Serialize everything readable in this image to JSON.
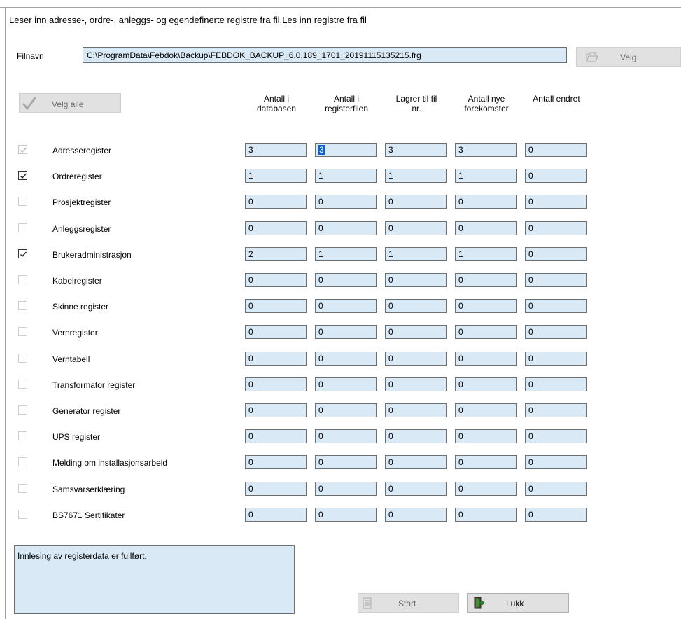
{
  "header": {
    "title": "Leser inn adresse-, ordre-, anleggs- og egendefinerte registre fra fil.Les inn registre fra fil"
  },
  "file": {
    "label": "Filnavn",
    "path": "C:\\ProgramData\\Febdok\\Backup\\FEBDOK_BACKUP_6.0.189_1701_20191115135215.frg",
    "button_label": "Velg"
  },
  "select_all_label": "Velg alle",
  "columns": [
    {
      "line1": "Antall i",
      "line2": "databasen"
    },
    {
      "line1": "Antall i",
      "line2": "registerfilen"
    },
    {
      "line1": "Lagrer til fil",
      "line2": "nr."
    },
    {
      "line1": "Antall nye",
      "line2": "forekomster"
    },
    {
      "line1": "Antall endret",
      "line2": ""
    }
  ],
  "rows": [
    {
      "name": "Adresseregister",
      "checked": true,
      "enabled": false,
      "values": [
        "3",
        "3",
        "3",
        "3",
        "0"
      ]
    },
    {
      "name": "Ordreregister",
      "checked": true,
      "enabled": true,
      "values": [
        "1",
        "1",
        "1",
        "1",
        "0"
      ]
    },
    {
      "name": "Prosjektregister",
      "checked": false,
      "enabled": false,
      "values": [
        "0",
        "0",
        "0",
        "0",
        "0"
      ]
    },
    {
      "name": "Anleggsregister",
      "checked": false,
      "enabled": false,
      "values": [
        "0",
        "0",
        "0",
        "0",
        "0"
      ]
    },
    {
      "name": "Brukeradministrasjon",
      "checked": true,
      "enabled": true,
      "values": [
        "2",
        "1",
        "1",
        "1",
        "0"
      ]
    },
    {
      "name": "Kabelregister",
      "checked": false,
      "enabled": false,
      "values": [
        "0",
        "0",
        "0",
        "0",
        "0"
      ]
    },
    {
      "name": "Skinne register",
      "checked": false,
      "enabled": false,
      "values": [
        "0",
        "0",
        "0",
        "0",
        "0"
      ]
    },
    {
      "name": "Vernregister",
      "checked": false,
      "enabled": false,
      "values": [
        "0",
        "0",
        "0",
        "0",
        "0"
      ]
    },
    {
      "name": "Verntabell",
      "checked": false,
      "enabled": false,
      "values": [
        "0",
        "0",
        "0",
        "0",
        "0"
      ]
    },
    {
      "name": "Transformator register",
      "checked": false,
      "enabled": false,
      "values": [
        "0",
        "0",
        "0",
        "0",
        "0"
      ]
    },
    {
      "name": "Generator register",
      "checked": false,
      "enabled": false,
      "values": [
        "0",
        "0",
        "0",
        "0",
        "0"
      ]
    },
    {
      "name": "UPS register",
      "checked": false,
      "enabled": false,
      "values": [
        "0",
        "0",
        "0",
        "0",
        "0"
      ]
    },
    {
      "name": "Melding om installasjonsarbeid",
      "checked": false,
      "enabled": false,
      "values": [
        "0",
        "0",
        "0",
        "0",
        "0"
      ]
    },
    {
      "name": "Samsvarserklæring",
      "checked": false,
      "enabled": false,
      "values": [
        "0",
        "0",
        "0",
        "0",
        "0"
      ]
    },
    {
      "name": "BS7671 Sertifikater",
      "checked": false,
      "enabled": false,
      "values": [
        "0",
        "0",
        "0",
        "0",
        "0"
      ]
    }
  ],
  "status_text": "Innlesing av registerdata er fullført.",
  "buttons": {
    "start_label": "Start",
    "close_label": "Lukk"
  },
  "colors": {
    "field_bg": "#d9e9f5",
    "field_border": "#6f6f6f",
    "selection": "#0a64d8",
    "button_bg": "#e1e1e1"
  }
}
